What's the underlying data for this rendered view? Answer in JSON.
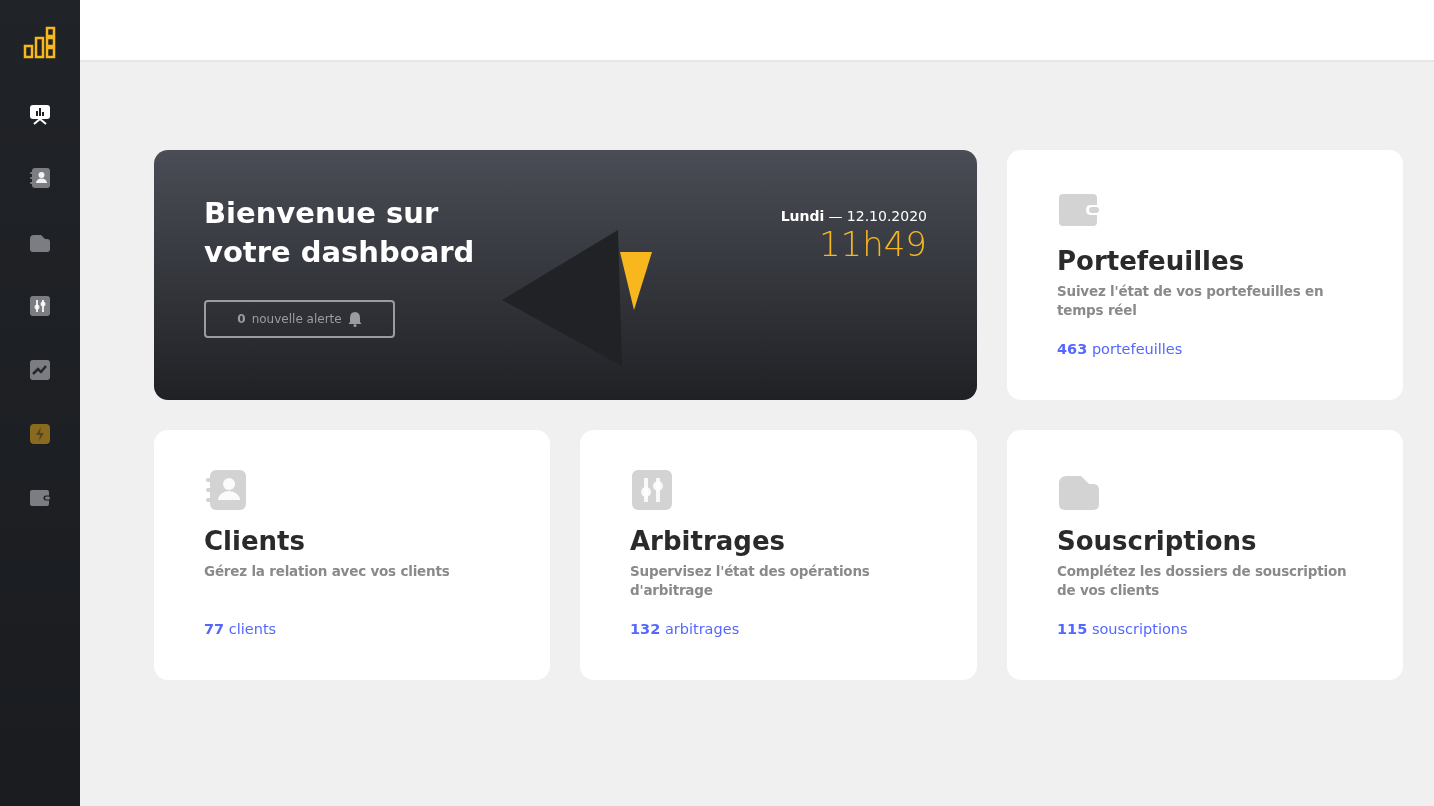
{
  "sidebar": {
    "items": [
      {
        "kind": "presentation",
        "selected": true,
        "accent": false
      },
      {
        "kind": "contacts",
        "selected": false,
        "accent": false
      },
      {
        "kind": "folder",
        "selected": false,
        "accent": false
      },
      {
        "kind": "sliders",
        "selected": false,
        "accent": false
      },
      {
        "kind": "chart",
        "selected": false,
        "accent": false
      },
      {
        "kind": "bolt",
        "selected": false,
        "accent": true
      },
      {
        "kind": "wallet",
        "selected": false,
        "accent": false
      }
    ]
  },
  "welcome": {
    "title": "Bienvenue sur votre dashboard",
    "alert_count": "0",
    "alert_label": "nouvelle alerte",
    "day": "Lundi",
    "date": "— 12.10.2020",
    "time": "11h49"
  },
  "cards": [
    {
      "kind": "wallet",
      "title": "Portefeuilles",
      "description": "Suivez l'état de vos portefeuilles en temps réel",
      "count": "463",
      "unit": "portefeuilles"
    },
    {
      "kind": "contacts",
      "title": "Clients",
      "description": "Gérez la relation avec vos clients",
      "count": "77",
      "unit": "clients"
    },
    {
      "kind": "sliders",
      "title": "Arbitrages",
      "description": "Supervisez l'état des opérations d'arbitrage",
      "count": "132",
      "unit": "arbitrages"
    },
    {
      "kind": "folder",
      "title": "Souscriptions",
      "description": "Complétez les dossiers de souscription de vos clients",
      "count": "115",
      "unit": "souscriptions"
    }
  ]
}
